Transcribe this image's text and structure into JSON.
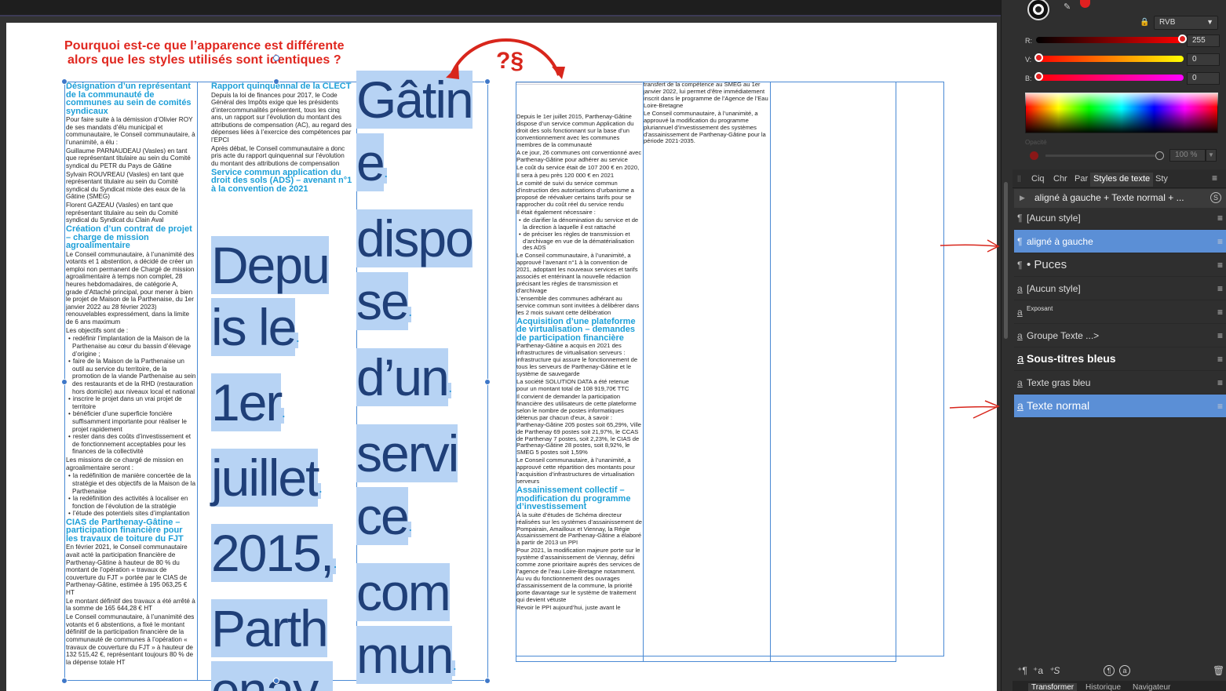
{
  "question": {
    "line1": "Pourquoi est-ce que l’apparence est différente",
    "line2": "alors que les styles utilisés sont identiques ?",
    "mark": "?§"
  },
  "col1": {
    "h1": "Désignation d’un représentant de la communauté de communes au sein de comités syndicaux",
    "p1": "Pour faire suite à la démission d’Olivier ROY de ses mandats d’élu municipal et communautaire, le Conseil communautaire, à l’unanimité, a élu :",
    "p2": "Guillaume PARNAUDEAU (Vasles) en tant que représentant titulaire au sein du Comité syndical du PETR du Pays de Gâtine",
    "p3": "Sylvain ROUVREAU (Vasles) en tant que représentant titulaire au sein du Comité syndical du Syndicat mixte des eaux de la Gâtine (SMEG)",
    "p4": "Florent GAZEAU (Vasles) en tant que représentant titulaire au sein du Comité syndical du Syndicat du Clain Aval",
    "h2": "Création d’un contrat de projet – charge de mission agroalimentaire",
    "p5": "Le Conseil communautaire, à l’unanimité des votants et 1 abstention, a décidé de créer un emploi non permanent de Chargé de mission agroalimentaire à temps non complet, 28 heures hebdomadaires, de catégorie A, grade d’Attaché principal, pour mener à bien le projet de Maison de la Parthenaise, du 1er janvier 2022 au 28 février 2023) renouvelables expressément, dans la limite de 6 ans maximum",
    "p6": "Les objectifs sont de :",
    "b1": "redéfinir l’implantation de la Maison de la Parthenaise au cœur du bassin d’élevage d’origine ;",
    "b2": "faire de la Maison de la Parthenaise un outil au service du territoire, de la promotion de la viande Parthenaise au sein des restaurants et de la RHD (restauration hors domicile) aux niveaux local et national",
    "b3": "inscrire le projet dans un vrai projet de territoire",
    "b4": "bénéficier d’une superficie foncière suffisamment importante pour réaliser le projet rapidement",
    "b5": "rester dans des coûts d’investissement et de fonctionnement acceptables pour les finances de la collectivité",
    "p7": "Les missions de ce chargé de mission en agroalimentaire seront :",
    "b6": "la redéfinition de manière concertée de la stratégie et des objectifs de la Maison de la Parthenaise",
    "b7": "la redéfinition des activités à localiser en fonction de l’évolution de la stratégie",
    "b8": "l’étude des potentiels sites d’implantation",
    "h3": "CIAS de Parthenay-Gâtine – participation financière pour les travaux de toiture du FJT",
    "p8": "En février 2021, le Conseil communautaire avait acté la participation financière de Parthenay-Gâtine à hauteur de 80 % du montant de l’opération « travaux de couverture du FJT » portée par le CIAS de Parthenay-Gâtine, estimée à 195 063,25 € HT",
    "p9": "Le montant définitif des travaux a été arrêté à la somme de 165 644,28 € HT",
    "p10": "Le Conseil communautaire, à l’unanimité des votants et 6 abstentions, a fixé le montant définitif de la participation financière de la communauté de communes à l’opération « travaux de couverture du FJT » à hauteur de 132 515,42 €, représentant toujours 80 % de la dépense totale HT"
  },
  "col2": {
    "h1": "Rapport quinquennal de la CLECT",
    "p1": "Depuis la loi de finances pour 2017, le Code Général des Impôts exige que les présidents d’intercommunalités présentent, tous les cinq ans, un rapport sur l’évolution du montant des attributions de compensation (AC), au regard des dépenses liées à l’exercice des compétences par l’EPCI",
    "p2": "Après débat, le Conseil communautaire a donc pris acte du rapport quinquennal sur l’évolution du montant des attributions de compensation",
    "h2": "Service commun application du droit des sols (ADS) – avenant n°1 à la convention de 2021",
    "big": [
      "Depu",
      "is le",
      "1er",
      "juillet",
      "2015,",
      "Parth",
      "enay-"
    ]
  },
  "col3": {
    "big": [
      "Gâtin",
      "e",
      "dispo",
      "se",
      "d’un",
      "servi",
      "ce",
      "com",
      "mun"
    ]
  },
  "col4": {
    "p1": "Depuis le 1er juillet 2015, Parthenay-Gâtine dispose d’un service commun Application du droit des sols fonctionnant sur la base d’un conventionnement avec les communes membres de la communauté",
    "p2": "A ce jour, 26 communes ont conventionné avec Parthenay-Gâtine pour adhérer au service",
    "p3": "Le coût du service était de 107 200 € en 2020,",
    "p4": "Il sera à peu près 120 000 € en 2021",
    "p5": "Le comité de suivi du service commun d’instruction des autorisations d’urbanisme a proposé de réévaluer certains tarifs pour se rapprocher du coût réel du service rendu",
    "p6": "Il était également nécessaire :",
    "b1": "de clarifier la dénomination du service et de la direction à laquelle il est rattaché",
    "b2": "de préciser les règles de transmission et d’archivage en vue de la dématérialisation des ADS",
    "p7": "Le Conseil communautaire, à l’unanimité, a approuvé l’avenant n°1 à la convention de 2021, adoptant les nouveaux services et tarifs associés et entérinant la nouvelle rédaction précisant les règles de transmission et d’archivage",
    "p8": "L’ensemble des communes adhérant au service commun sont invitées à délibérer dans les 2 mois suivant cette délibération",
    "h1": "Acquisition d’une plateforme de virtualisation – demandes de participation financière",
    "p9": "Parthenay-Gâtine a acquis en 2021 des infrastructures de virtualisation serveurs : infrastructure qui assure le fonctionnement de tous les serveurs de Parthenay-Gâtine et le système de sauvegarde",
    "p10": "La société SOLUTION DATA a été retenue pour un montant total de 108 919,70€ TTC",
    "p11": "Il convient de demander la participation financière des utilisateurs de cette plateforme selon le nombre de postes informatiques détenus par chacun d’eux, à savoir : Parthenay-Gâtine 205 postes soit 65,29%, Ville de Parthenay 69 postes soit 21,97%, le CCAS de Parthenay 7 postes, soit 2,23%, le CIAS de Parthenay-Gâtine 28 postes, soit 8,92%, le SMEG 5 postes soit 1,59%",
    "p12": "Le Conseil communautaire, à l’unanimité, a approuvé cette répartition des montants pour l’acquisition d’infrastructures de virtualisation serveurs",
    "h2": "Assainissement collectif – modification du programme d’investissement",
    "p13": "À la suite d’études de Schéma directeur réalisées sur les systèmes d’assainissement de Pompairain, Amailloux et Viennay, la Régie Assainissement de Parthenay-Gâtine a élaboré à partir de 2013 un PPI",
    "p14": "Pour 2021, la modification majeure porte sur le système d’assainissement de Viennay, défini comme zone prioritaire auprès des services de l’agence de l’eau Loire-Bretagne notamment. Au vu du fonctionnement des ouvrages d’assainissement de la commune, la priorité porte davantage sur le système de traitement qui devient vétuste",
    "p15": "Revoir le PPI aujourd’hui, juste avant le"
  },
  "col5": {
    "p1": "transfert de la compétence au SMEG au 1er janvier 2022, lui permet d’être immédiatement inscrit dans le programme de l’Agence de l’Eau Loire-Bretagne",
    "p2": "Le Conseil communautaire, à l’unanimité, a approuvé la modification du programme pluriannuel d’investissement des systèmes d’assainissement de Parthenay-Gâtine pour la période 2021-2035."
  },
  "panel": {
    "color_model": "RVB",
    "r_label": "R:",
    "r_value": "255",
    "g_label": "V:",
    "g_value": "0",
    "b_label": "B:",
    "b_value": "0",
    "opacity_label": "Opacité",
    "opacity_value": "100 %",
    "tabs": [
      "Ciq",
      "Chr",
      "Par",
      "Styles de texte",
      "Sty"
    ],
    "current_style": "aligné à gauche + Texte normal + ...",
    "styles": [
      {
        "glyph": "¶",
        "label": "[Aucun style]",
        "selected": false
      },
      {
        "glyph": "¶",
        "label": "aligné à gauche",
        "selected": true
      },
      {
        "glyph": "¶",
        "label": "• Puces",
        "selected": false
      },
      {
        "glyph": "a",
        "label": "[Aucun style]",
        "selected": false
      },
      {
        "glyph": "a",
        "label": "Exposant",
        "selected": false
      },
      {
        "glyph": "a",
        "label": "Groupe Texte ...>",
        "selected": false
      },
      {
        "glyph": "a",
        "label": "Sous-titres bleus",
        "selected": false
      },
      {
        "glyph": "a",
        "label": "Texte gras bleu",
        "selected": false
      },
      {
        "glyph": "a",
        "label": "Texte normal",
        "selected": true
      }
    ],
    "bottom_icons": [
      "⁺¶",
      "⁺a",
      "⁺S"
    ],
    "bottom_tabs": [
      "Transformer",
      "Historique",
      "Navigateur"
    ]
  },
  "colors": {
    "accent_blue": "#5b8fd6",
    "heading_cyan": "#1c9fd8",
    "question_red": "#e0261e",
    "highlight": "#b7d3f4",
    "big_text": "#1f3f78"
  }
}
